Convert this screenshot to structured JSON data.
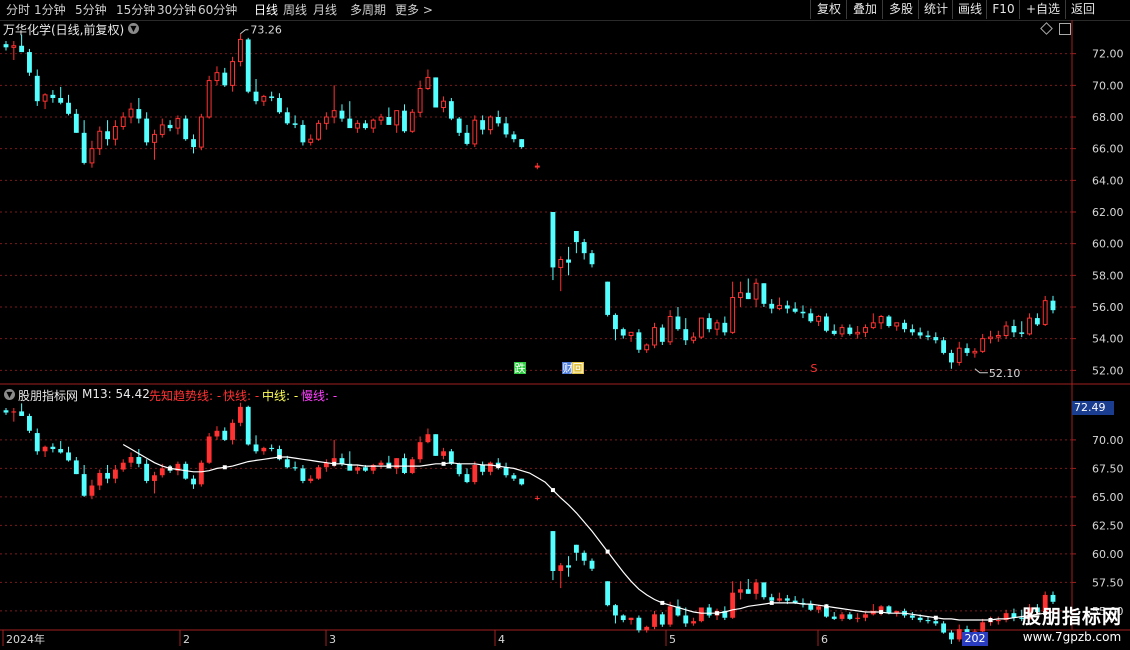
{
  "toolbar": {
    "periods": [
      "分时",
      "1分钟",
      "5分钟",
      "15分钟",
      "30分钟",
      "60分钟",
      "日线",
      "周线",
      "月线",
      "多周期",
      "更多 >"
    ],
    "active_period": "日线",
    "right_buttons": [
      "复权",
      "叠加",
      "多股",
      "统计",
      "画线",
      "F10",
      "+自选",
      "返回"
    ]
  },
  "main_panel": {
    "title": "万华化学(日线,前复权)",
    "high_label": "73.26",
    "low_label": "52.10",
    "markers": [
      "跌",
      "财",
      "回",
      "S"
    ]
  },
  "indicator_panel": {
    "name": "股朋指标网",
    "m13_label": "M13: 54.42",
    "legend_xianzhi": "先知趋势线: -",
    "legend_kuai": "快线: -",
    "legend_zhong": "中线: -",
    "legend_man": "慢线: -",
    "badge_value": "72.49"
  },
  "x_axis": {
    "labels": [
      "2024年",
      "2",
      "3",
      "4",
      "5",
      "6"
    ],
    "current_date_badge": "202"
  },
  "watermark": {
    "title": "股朋指标网",
    "url": "www.7gpzb.com"
  },
  "colors": {
    "up": "#ff3232",
    "down": "#54ffff",
    "ma": "#ffffff",
    "grid": "#7a1a1a",
    "axis_border": "#a02020"
  },
  "chart_data": {
    "type": "candlestick",
    "main_ylim": [
      51.2,
      74.0
    ],
    "main_ticks": [
      "72.00",
      "70.00",
      "68.00",
      "66.00",
      "64.00",
      "62.00",
      "60.00",
      "58.00",
      "56.00",
      "54.00",
      "52.00"
    ],
    "ind_ylim": [
      53.5,
      73.5
    ],
    "ind_ticks": [
      "70.00",
      "67.50",
      "65.00",
      "62.50",
      "60.00",
      "57.50",
      "55.00"
    ],
    "candles": [
      [
        72.6,
        72.8,
        72.2,
        72.4
      ],
      [
        72.4,
        72.8,
        71.6,
        72.5
      ],
      [
        72.5,
        73.2,
        72.1,
        72.1
      ],
      [
        72.1,
        72.3,
        70.6,
        70.8
      ],
      [
        70.6,
        71.0,
        68.7,
        69.0
      ],
      [
        69.0,
        69.5,
        68.5,
        69.4
      ],
      [
        69.4,
        69.7,
        68.9,
        69.2
      ],
      [
        69.2,
        69.9,
        68.8,
        68.9
      ],
      [
        68.9,
        69.4,
        68.1,
        68.2
      ],
      [
        68.2,
        68.5,
        67.0,
        67.0
      ],
      [
        67.0,
        67.8,
        65.0,
        65.1
      ],
      [
        65.1,
        66.5,
        64.8,
        66.0
      ],
      [
        66.0,
        67.4,
        65.6,
        67.1
      ],
      [
        67.1,
        67.8,
        66.2,
        66.6
      ],
      [
        66.6,
        67.8,
        66.2,
        67.4
      ],
      [
        67.4,
        68.3,
        67.2,
        68.0
      ],
      [
        68.0,
        68.9,
        67.6,
        68.5
      ],
      [
        68.5,
        69.2,
        67.6,
        67.9
      ],
      [
        67.9,
        68.3,
        66.2,
        66.4
      ],
      [
        66.4,
        67.2,
        65.3,
        66.9
      ],
      [
        66.9,
        67.9,
        66.7,
        67.5
      ],
      [
        67.5,
        67.8,
        67.1,
        67.3
      ],
      [
        67.3,
        68.1,
        66.9,
        67.9
      ],
      [
        67.9,
        68.1,
        66.5,
        66.6
      ],
      [
        66.6,
        66.9,
        65.7,
        66.1
      ],
      [
        66.1,
        68.2,
        65.9,
        68.0
      ],
      [
        68.0,
        70.6,
        67.9,
        70.3
      ],
      [
        70.3,
        71.2,
        70.0,
        70.8
      ],
      [
        70.8,
        71.1,
        69.9,
        70.0
      ],
      [
        70.0,
        71.8,
        69.6,
        71.5
      ],
      [
        71.5,
        73.26,
        71.2,
        72.9
      ],
      [
        72.9,
        73.0,
        69.5,
        69.6
      ],
      [
        69.6,
        70.4,
        68.8,
        69.0
      ],
      [
        69.0,
        69.4,
        68.7,
        69.3
      ],
      [
        69.3,
        69.6,
        69.0,
        69.2
      ],
      [
        69.2,
        69.5,
        68.2,
        68.3
      ],
      [
        68.3,
        68.6,
        67.5,
        67.6
      ],
      [
        67.6,
        68.1,
        67.3,
        67.5
      ],
      [
        67.5,
        67.8,
        66.2,
        66.4
      ],
      [
        66.4,
        66.9,
        66.2,
        66.6
      ],
      [
        66.6,
        67.8,
        66.5,
        67.6
      ],
      [
        67.6,
        68.3,
        67.2,
        68.0
      ],
      [
        68.0,
        70.0,
        67.6,
        68.4
      ],
      [
        68.4,
        68.8,
        67.7,
        67.9
      ],
      [
        67.9,
        69.0,
        67.5,
        67.3
      ],
      [
        67.3,
        67.8,
        67.0,
        67.6
      ],
      [
        67.6,
        67.8,
        67.2,
        67.3
      ],
      [
        67.3,
        67.9,
        67.0,
        67.8
      ],
      [
        67.8,
        68.2,
        67.5,
        68.0
      ],
      [
        68.0,
        68.6,
        67.6,
        67.5
      ],
      [
        67.5,
        68.4,
        67.0,
        68.4
      ],
      [
        68.4,
        68.8,
        67.0,
        67.1
      ],
      [
        67.1,
        68.5,
        67.0,
        68.3
      ],
      [
        68.3,
        70.3,
        68.0,
        69.8
      ],
      [
        69.8,
        71.0,
        69.7,
        70.5
      ],
      [
        70.5,
        70.5,
        68.6,
        68.6
      ],
      [
        68.6,
        69.3,
        68.3,
        69.0
      ],
      [
        69.0,
        69.2,
        67.8,
        67.9
      ],
      [
        67.9,
        68.0,
        66.8,
        67.0
      ],
      [
        67.0,
        67.5,
        66.2,
        66.3
      ],
      [
        66.3,
        68.1,
        66.1,
        67.8
      ],
      [
        67.8,
        68.1,
        66.9,
        67.2
      ],
      [
        67.2,
        68.1,
        66.9,
        68.0
      ],
      [
        68.0,
        68.4,
        67.4,
        67.6
      ],
      [
        67.6,
        68.0,
        66.7,
        66.9
      ],
      [
        66.9,
        67.1,
        66.4,
        66.6
      ],
      [
        66.6,
        66.6,
        66.0,
        66.1
      ],
      null,
      [
        64.9,
        65.1,
        64.7,
        64.9
      ],
      null,
      [
        62.0,
        62.0,
        57.7,
        58.5
      ],
      [
        58.5,
        59.2,
        57.0,
        59.0
      ],
      [
        59.0,
        59.8,
        58.0,
        58.8
      ],
      [
        60.8,
        60.8,
        59.4,
        60.1
      ],
      [
        60.1,
        60.3,
        59.0,
        59.4
      ],
      [
        59.4,
        59.6,
        58.5,
        58.7
      ],
      null,
      [
        57.6,
        57.6,
        55.4,
        55.5
      ],
      [
        55.5,
        55.6,
        53.9,
        54.6
      ],
      [
        54.6,
        54.7,
        54.0,
        54.2
      ],
      [
        54.2,
        54.4,
        53.8,
        54.4
      ],
      [
        54.4,
        54.6,
        53.1,
        53.3
      ],
      [
        53.3,
        53.7,
        53.1,
        53.6
      ],
      [
        53.6,
        55.0,
        53.4,
        54.7
      ],
      [
        54.7,
        54.9,
        53.6,
        53.8
      ],
      [
        53.8,
        55.8,
        53.6,
        55.4
      ],
      [
        55.4,
        56.0,
        54.5,
        54.6
      ],
      [
        54.6,
        55.3,
        53.6,
        53.9
      ],
      [
        53.9,
        54.4,
        53.7,
        54.1
      ],
      [
        54.1,
        55.3,
        54.0,
        55.3
      ],
      [
        55.3,
        55.6,
        54.4,
        54.6
      ],
      [
        54.6,
        55.2,
        54.2,
        55.0
      ],
      [
        55.0,
        55.4,
        54.2,
        54.4
      ],
      [
        54.4,
        57.6,
        54.3,
        56.6
      ],
      [
        56.6,
        57.6,
        56.0,
        56.9
      ],
      [
        56.9,
        57.8,
        56.5,
        56.5
      ],
      [
        56.5,
        57.8,
        56.0,
        57.5
      ],
      [
        57.5,
        57.5,
        56.0,
        56.2
      ],
      [
        56.2,
        56.5,
        55.6,
        55.9
      ],
      [
        55.9,
        56.6,
        55.8,
        56.1
      ],
      [
        56.1,
        56.4,
        55.6,
        55.9
      ],
      [
        55.9,
        56.3,
        55.6,
        55.7
      ],
      [
        55.7,
        56.1,
        55.3,
        55.6
      ],
      [
        55.6,
        55.9,
        55.0,
        55.1
      ],
      [
        55.1,
        55.5,
        54.8,
        55.4
      ],
      [
        55.4,
        55.6,
        54.4,
        54.5
      ],
      [
        54.5,
        54.9,
        54.2,
        54.3
      ],
      [
        54.3,
        54.9,
        54.1,
        54.7
      ],
      [
        54.7,
        54.9,
        54.2,
        54.3
      ],
      [
        54.3,
        54.8,
        54.0,
        54.4
      ],
      [
        54.4,
        54.9,
        54.1,
        54.7
      ],
      [
        54.7,
        55.6,
        54.6,
        55.0
      ],
      [
        55.0,
        55.5,
        54.6,
        55.4
      ],
      [
        55.4,
        55.5,
        54.7,
        54.8
      ],
      [
        54.8,
        55.0,
        54.5,
        55.0
      ],
      [
        55.0,
        55.2,
        54.4,
        54.6
      ],
      [
        54.6,
        54.9,
        54.2,
        54.4
      ],
      [
        54.4,
        54.7,
        54.0,
        54.2
      ],
      [
        54.2,
        54.5,
        53.9,
        54.1
      ],
      [
        54.1,
        54.4,
        53.7,
        53.9
      ],
      [
        53.9,
        54.1,
        53.0,
        53.1
      ],
      [
        53.1,
        53.3,
        52.1,
        52.5
      ],
      [
        52.5,
        53.8,
        52.3,
        53.4
      ],
      [
        53.4,
        53.7,
        52.9,
        53.1
      ],
      [
        53.1,
        53.4,
        52.8,
        53.2
      ],
      [
        53.2,
        54.3,
        53.1,
        54.0
      ],
      [
        54.0,
        54.5,
        53.7,
        54.1
      ],
      [
        54.1,
        54.5,
        53.8,
        54.2
      ],
      [
        54.2,
        55.1,
        54.0,
        54.8
      ],
      [
        54.8,
        55.2,
        54.1,
        54.4
      ],
      [
        54.4,
        55.1,
        54.1,
        54.3
      ],
      [
        54.3,
        55.6,
        54.2,
        55.3
      ],
      [
        55.3,
        55.6,
        54.8,
        54.9
      ],
      [
        54.9,
        56.7,
        54.8,
        56.4
      ],
      [
        56.4,
        56.7,
        55.6,
        55.8
      ]
    ],
    "ma": [
      null,
      null,
      null,
      null,
      null,
      null,
      null,
      null,
      null,
      null,
      null,
      null,
      null,
      null,
      null,
      69.6,
      69.2,
      68.8,
      68.4,
      68.0,
      67.7,
      67.5,
      67.4,
      67.3,
      67.2,
      67.2,
      67.3,
      67.5,
      67.6,
      67.7,
      67.9,
      68.1,
      68.2,
      68.3,
      68.4,
      68.5,
      68.5,
      68.4,
      68.3,
      68.2,
      68.1,
      68.0,
      67.9,
      67.9,
      67.8,
      67.8,
      67.7,
      67.7,
      67.7,
      67.7,
      67.7,
      67.7,
      67.7,
      67.7,
      67.8,
      67.9,
      67.9,
      68.0,
      67.9,
      67.9,
      67.9,
      67.8,
      67.8,
      67.7,
      67.6,
      67.5,
      67.3,
      67.1,
      66.7,
      66.3,
      65.6,
      64.9,
      64.3,
      63.6,
      62.8,
      62.0,
      61.1,
      60.2,
      59.3,
      58.4,
      57.6,
      56.9,
      56.4,
      56.0,
      55.7,
      55.5,
      55.3,
      55.1,
      54.9,
      54.8,
      54.8,
      54.8,
      54.9,
      55.1,
      55.2,
      55.4,
      55.5,
      55.6,
      55.7,
      55.7,
      55.7,
      55.7,
      55.6,
      55.6,
      55.5,
      55.4,
      55.3,
      55.2,
      55.1,
      55.0,
      54.9,
      54.9,
      54.9,
      54.8,
      54.8,
      54.8,
      54.7,
      54.6,
      54.5,
      54.4,
      54.3,
      54.3,
      54.2,
      54.2,
      54.2,
      54.2,
      54.2,
      54.3,
      54.3,
      54.4,
      54.5,
      54.6,
      54.7,
      54.8,
      54.9
    ]
  }
}
